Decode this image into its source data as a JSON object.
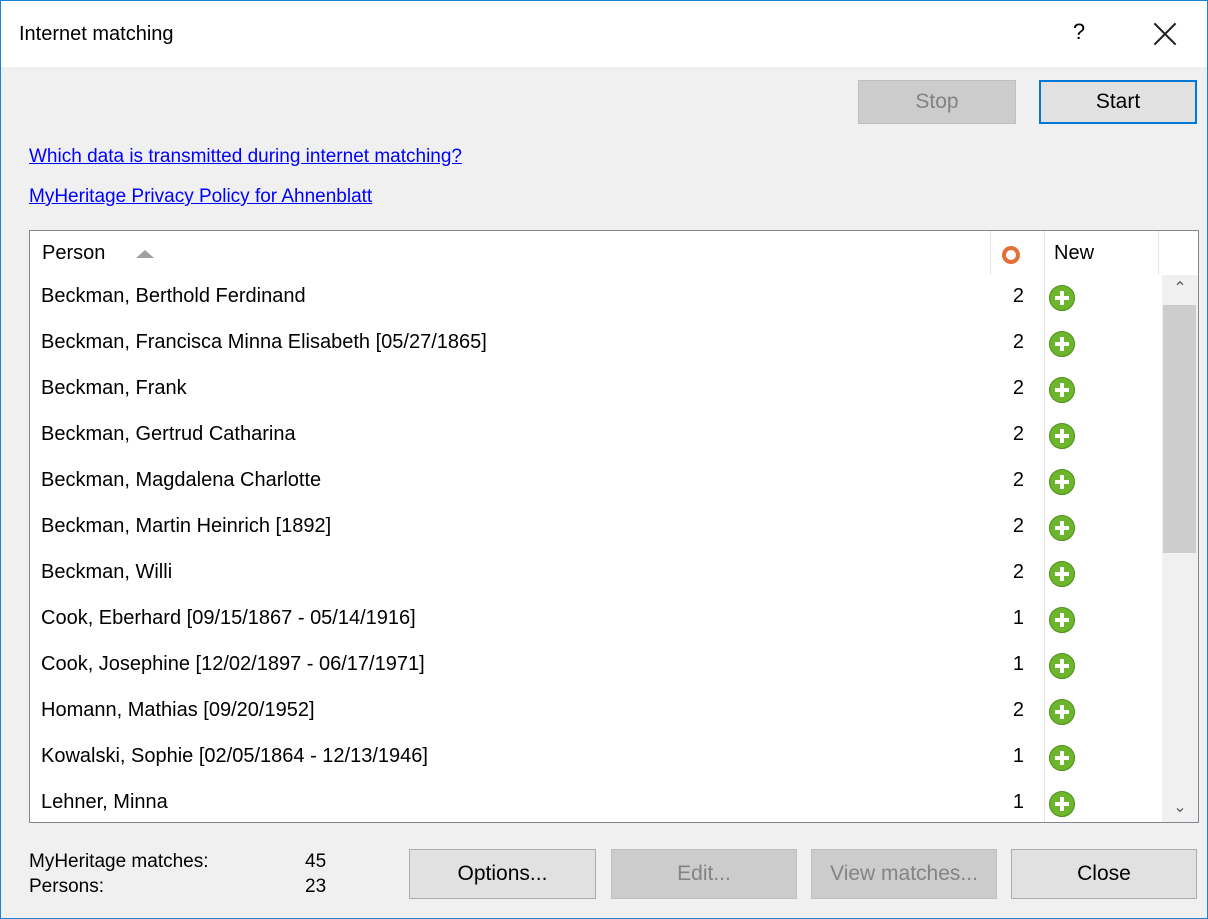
{
  "window": {
    "title": "Internet matching",
    "help": "?"
  },
  "toolbar": {
    "stop_label": "Stop",
    "start_label": "Start"
  },
  "links": {
    "transmitted": "Which data is transmitted during internet matching?",
    "privacy": "MyHeritage Privacy Policy for Ahnenblatt"
  },
  "table": {
    "columns": {
      "person": "Person",
      "matches_icon": "myheritage-icon",
      "new": "New"
    },
    "rows": [
      {
        "name": "Beckman, Berthold Ferdinand",
        "count": "2",
        "new_icon": "plus-icon"
      },
      {
        "name": "Beckman, Francisca Minna Elisabeth [05/27/1865]",
        "count": "2",
        "new_icon": "plus-icon"
      },
      {
        "name": "Beckman, Frank",
        "count": "2",
        "new_icon": "plus-icon"
      },
      {
        "name": "Beckman, Gertrud Catharina",
        "count": "2",
        "new_icon": "plus-icon"
      },
      {
        "name": "Beckman, Magdalena Charlotte",
        "count": "2",
        "new_icon": "plus-icon"
      },
      {
        "name": "Beckman, Martin Heinrich [1892]",
        "count": "2",
        "new_icon": "plus-icon"
      },
      {
        "name": "Beckman, Willi",
        "count": "2",
        "new_icon": "plus-icon"
      },
      {
        "name": "Cook, Eberhard [09/15/1867 - 05/14/1916]",
        "count": "1",
        "new_icon": "plus-icon"
      },
      {
        "name": "Cook, Josephine [12/02/1897 - 06/17/1971]",
        "count": "1",
        "new_icon": "plus-icon"
      },
      {
        "name": "Homann, Mathias [09/20/1952]",
        "count": "2",
        "new_icon": "plus-icon"
      },
      {
        "name": "Kowalski, Sophie [02/05/1864 - 12/13/1946]",
        "count": "1",
        "new_icon": "plus-icon"
      },
      {
        "name": "Lehner, Minna",
        "count": "1",
        "new_icon": "plus-icon"
      }
    ]
  },
  "stats": {
    "matches_label": "MyHeritage matches:",
    "matches_value": "45",
    "persons_label": "Persons:",
    "persons_value": "23"
  },
  "footer": {
    "options_label": "Options...",
    "edit_label": "Edit...",
    "view_label": "View matches...",
    "close_label": "Close"
  },
  "colors": {
    "accent": "#0078d7",
    "link": "#0000ff",
    "plus": "#6cb52d",
    "brand": "#e2703a"
  }
}
